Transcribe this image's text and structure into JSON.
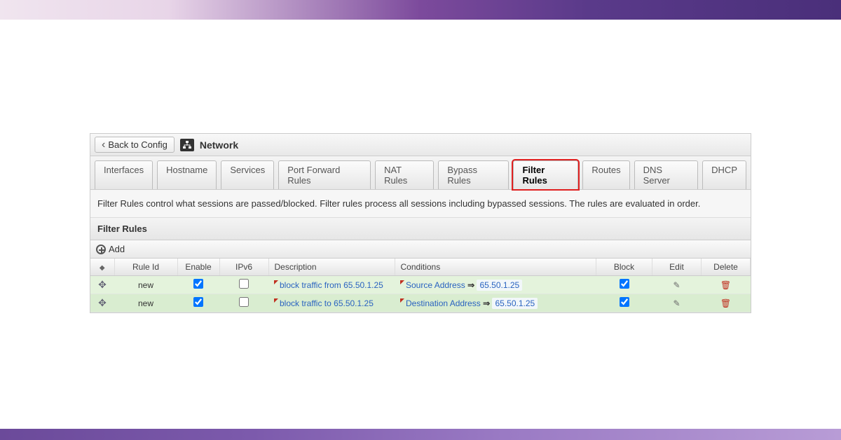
{
  "header": {
    "back_label": "Back to Config",
    "network_label": "Network"
  },
  "tabs": [
    "Interfaces",
    "Hostname",
    "Services",
    "Port Forward Rules",
    "NAT Rules",
    "Bypass Rules",
    "Filter Rules",
    "Routes",
    "DNS Server",
    "DHCP"
  ],
  "active_tab_index": 6,
  "description": "Filter Rules control what sessions are passed/blocked. Filter rules process all sessions including bypassed sessions. The rules are evaluated in order.",
  "section_title": "Filter Rules",
  "add_label": "Add",
  "columns": {
    "rule_id": "Rule Id",
    "enable": "Enable",
    "ipv6": "IPv6",
    "description": "Description",
    "conditions": "Conditions",
    "block": "Block",
    "edit": "Edit",
    "delete": "Delete"
  },
  "rows": [
    {
      "rule_id": "new",
      "enable": true,
      "ipv6": false,
      "description": "block traffic from 65.50.1.25",
      "condition_label": "Source Address",
      "condition_value": "65.50.1.25",
      "block": true
    },
    {
      "rule_id": "new",
      "enable": true,
      "ipv6": false,
      "description": "block traffic to 65.50.1.25",
      "condition_label": "Destination Address",
      "condition_value": "65.50.1.25",
      "block": true
    }
  ]
}
